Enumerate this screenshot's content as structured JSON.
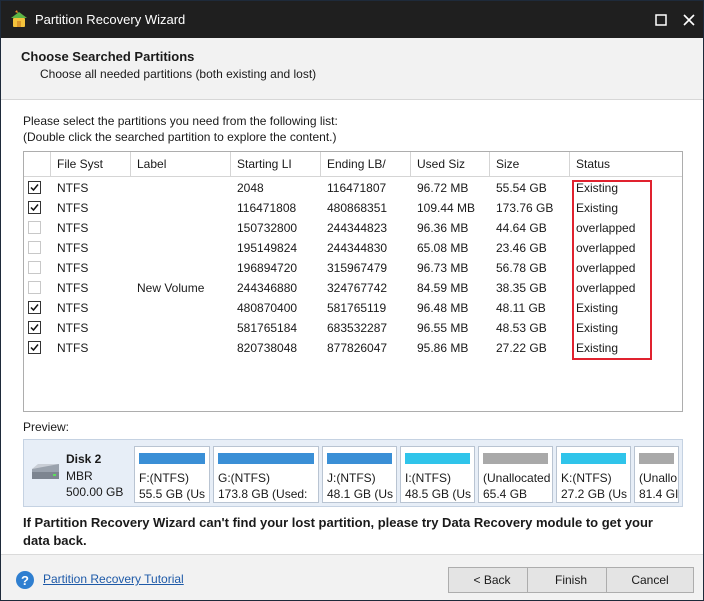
{
  "window": {
    "title": "Partition Recovery Wizard",
    "titlebar_color": "#1f1f1f"
  },
  "header": {
    "title": "Choose Searched Partitions",
    "subtitle": "Choose all needed partitions (both existing and lost)"
  },
  "instructions": {
    "line1": "Please select the partitions you need from the following list:",
    "line2": "(Double click the searched partition to explore the content.)"
  },
  "table": {
    "columns": [
      "File Syst",
      "Label",
      "Starting LI",
      "Ending LB/",
      "Used Siz",
      "Size",
      "Status"
    ],
    "rows": [
      {
        "checked": true,
        "fs": "NTFS",
        "label": "",
        "start": "2048",
        "end": "116471807",
        "used": "96.72 MB",
        "size": "55.54 GB",
        "status": "Existing"
      },
      {
        "checked": true,
        "fs": "NTFS",
        "label": "",
        "start": "116471808",
        "end": "480868351",
        "used": "109.44 MB",
        "size": "173.76 GB",
        "status": "Existing"
      },
      {
        "checked": false,
        "fs": "NTFS",
        "label": "",
        "start": "150732800",
        "end": "244344823",
        "used": "96.36 MB",
        "size": "44.64 GB",
        "status": "overlapped"
      },
      {
        "checked": false,
        "fs": "NTFS",
        "label": "",
        "start": "195149824",
        "end": "244344830",
        "used": "65.08 MB",
        "size": "23.46 GB",
        "status": "overlapped"
      },
      {
        "checked": false,
        "fs": "NTFS",
        "label": "",
        "start": "196894720",
        "end": "315967479",
        "used": "96.73 MB",
        "size": "56.78 GB",
        "status": "overlapped"
      },
      {
        "checked": false,
        "fs": "NTFS",
        "label": "New Volume",
        "start": "244346880",
        "end": "324767742",
        "used": "84.59 MB",
        "size": "38.35 GB",
        "status": "overlapped"
      },
      {
        "checked": true,
        "fs": "NTFS",
        "label": "",
        "start": "480870400",
        "end": "581765119",
        "used": "96.48 MB",
        "size": "48.11 GB",
        "status": "Existing"
      },
      {
        "checked": true,
        "fs": "NTFS",
        "label": "",
        "start": "581765184",
        "end": "683532287",
        "used": "96.55 MB",
        "size": "48.53 GB",
        "status": "Existing"
      },
      {
        "checked": true,
        "fs": "NTFS",
        "label": "",
        "start": "820738048",
        "end": "877826047",
        "used": "95.86 MB",
        "size": "27.22 GB",
        "status": "Existing"
      }
    ],
    "highlight_color": "#e0222f"
  },
  "preview": {
    "label": "Preview:",
    "disk": {
      "name": "Disk 2",
      "type": "MBR",
      "size": "500.00 GB"
    },
    "partitions": [
      {
        "line1": "F:(NTFS)",
        "line2": "55.5 GB (Us",
        "color": "#3a8fd6"
      },
      {
        "line1": "G:(NTFS)",
        "line2": "173.8 GB (Used:",
        "color": "#3a8fd6"
      },
      {
        "line1": "J:(NTFS)",
        "line2": "48.1 GB (Us",
        "color": "#3a8fd6"
      },
      {
        "line1": "I:(NTFS)",
        "line2": "48.5 GB (Us",
        "color": "#2fc4ea"
      },
      {
        "line1": "(Unallocated",
        "line2": "65.4 GB",
        "color": "#a9a9a9"
      },
      {
        "line1": "K:(NTFS)",
        "line2": "27.2 GB (Us",
        "color": "#2fc4ea"
      },
      {
        "line1": "(Unallo",
        "line2": "81.4 GI",
        "color": "#a9a9a9"
      }
    ]
  },
  "footer": {
    "note": "If Partition Recovery Wizard can't find your lost partition, please try Data Recovery module to get your data back.",
    "tutorial_link": "Partition Recovery Tutorial",
    "back_label": "< Back",
    "finish_label": "Finish",
    "cancel_label": "Cancel"
  },
  "icons": [
    "app-wizard-icon",
    "maximize-icon",
    "close-icon",
    "disk-icon",
    "help-icon",
    "checkmark-icon"
  ]
}
